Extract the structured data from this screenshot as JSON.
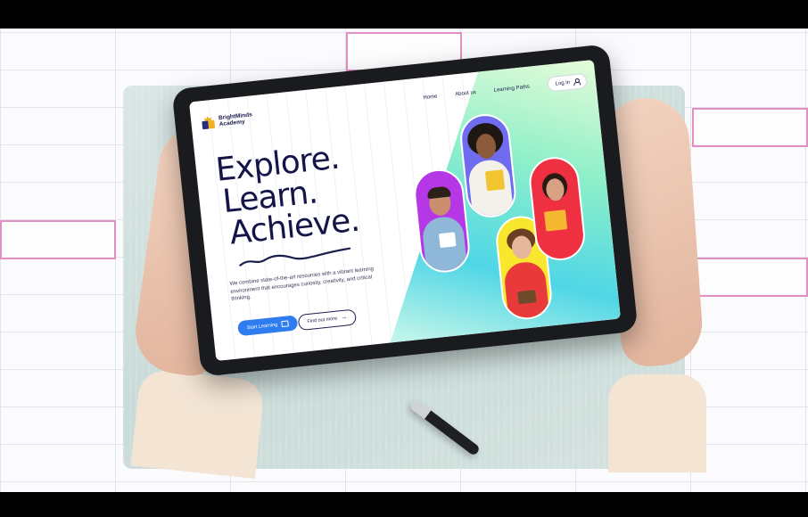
{
  "site": {
    "brand_line1": "BrightMinds",
    "brand_line2": "Academy"
  },
  "nav": {
    "items": [
      "Home",
      "About us",
      "Learning Paths"
    ],
    "login_label": "Log in"
  },
  "hero": {
    "line1": "Explore.",
    "line2": "Learn.",
    "line3": "Achieve.",
    "description": "We combine state-of-the-art resources with a vibrant learning environment that encourages curiosity, creativity, and critical thinking.",
    "primary_cta": "Start Learning",
    "secondary_cta": "Find out more"
  },
  "colors": {
    "brand_navy": "#1b1d4d",
    "primary_blue": "#2f7cf0",
    "pill_purple": "#b537e6",
    "pill_blue": "#6f6cf0",
    "pill_yellow": "#f8e72c",
    "pill_red": "#ef3040",
    "highlight_pink": "#e38fc2"
  },
  "icons": {
    "logo": "book-crown-icon",
    "login": "user-icon",
    "start": "graduation-cap-icon",
    "find": "arrow-right-icon"
  }
}
